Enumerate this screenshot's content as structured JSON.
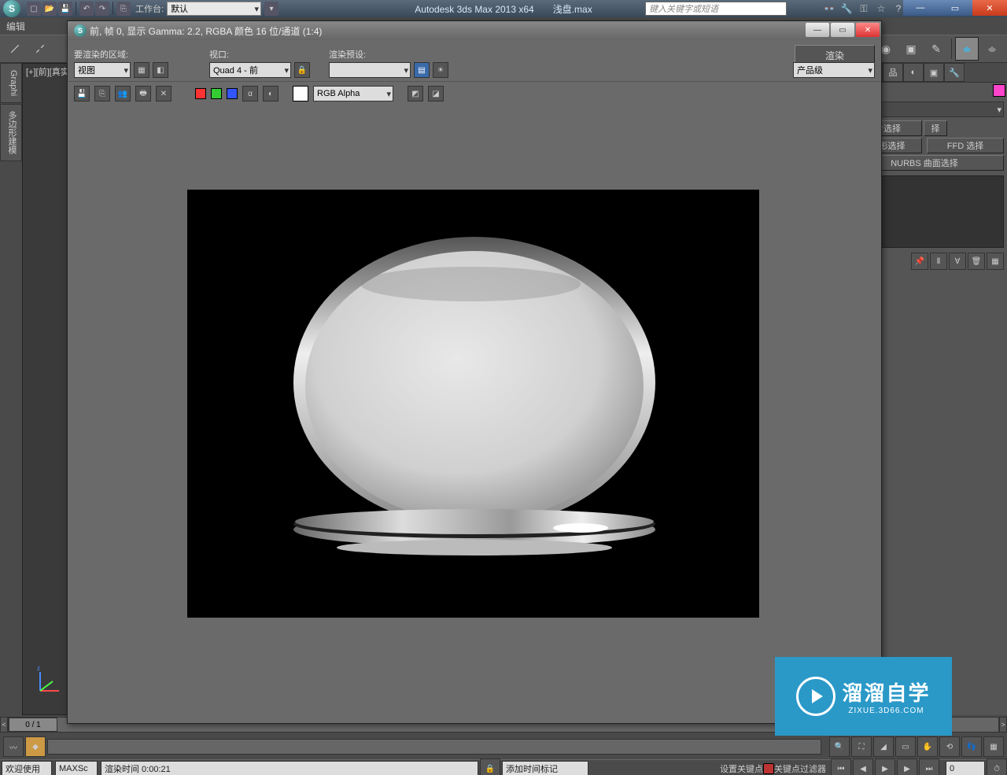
{
  "title": {
    "app": "Autodesk 3ds Max  2013 x64",
    "file": "浅盘.max",
    "workspace_label": "工作台:",
    "workspace_value": "默认",
    "search_placeholder": "键入关键字或短语"
  },
  "menubar": {
    "item": "编辑"
  },
  "left_tabs": [
    "Graphi",
    "多边形建模"
  ],
  "viewport_label": "[+][前][真实",
  "render_win": {
    "title": "前, 帧 0, 显示 Gamma: 2.2, RGBA 颜色 16 位/通道 (1:4)",
    "area_label": "要渲染的区域:",
    "area_value": "视图",
    "viewport_label": "视口:",
    "viewport_value": "Quad 4 - 前",
    "preset_label": "渲染预设:",
    "render_btn": "渲染",
    "product_level": "产品级",
    "channel_dd": "RGB Alpha"
  },
  "right_panel": {
    "buttons": [
      "面片选择",
      "多边形选择",
      "FFD 选择",
      "NURBS 曲面选择"
    ],
    "partial": "择"
  },
  "timeslider": {
    "thumb": "0 / 1"
  },
  "status": {
    "welcome": "欢迎使用",
    "maxscript": "MAXSc",
    "render_time": "渲染时间 0:00:21",
    "add_time_marker": "添加时间标记",
    "set_key": "设置关键点",
    "key_filter": "关键点过滤器"
  },
  "watermark": {
    "big": "溜溜自学",
    "small": "ZIXUE.3D66.COM"
  }
}
